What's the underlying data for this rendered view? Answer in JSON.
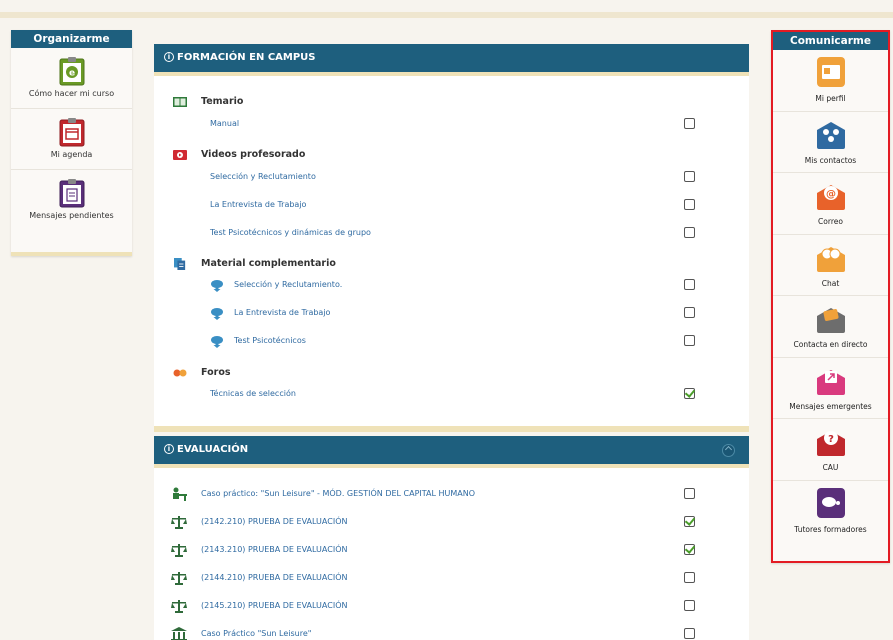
{
  "colors": {
    "header_blue": "#1e5f7e",
    "link_blue": "#2f6aa1",
    "highlight_red": "#e31b23",
    "stripe_beige": "#efe2b8"
  },
  "left_sidebar": {
    "title": "Organizarme",
    "items": [
      {
        "label": "Cómo hacer mi curso",
        "icon": "clipboard-question-icon"
      },
      {
        "label": "Mi agenda",
        "icon": "clipboard-calendar-icon"
      },
      {
        "label": "Mensajes pendientes",
        "icon": "clipboard-document-icon"
      }
    ]
  },
  "right_sidebar": {
    "title": "Comunicarme",
    "items": [
      {
        "label": "Mi perfil",
        "icon": "profile-card-icon"
      },
      {
        "label": "Mis contactos",
        "icon": "contacts-icon"
      },
      {
        "label": "Correo",
        "icon": "mail-at-icon"
      },
      {
        "label": "Chat",
        "icon": "chat-icon"
      },
      {
        "label": "Contacta en directo",
        "icon": "live-contact-icon"
      },
      {
        "label": "Mensajes emergentes",
        "icon": "popup-messages-icon"
      },
      {
        "label": "CAU",
        "icon": "help-desk-icon"
      },
      {
        "label": "Tutores formadores",
        "icon": "tutors-icon"
      }
    ]
  },
  "formacion": {
    "title": "FORMACIÓN EN CAMPUS",
    "categories": [
      {
        "title": "Temario",
        "icon": "book-icon",
        "items": [
          {
            "label": "Manual",
            "checked": false
          }
        ]
      },
      {
        "title": "Videos profesorado",
        "icon": "video-icon",
        "items": [
          {
            "label": "Selección y Reclutamiento",
            "checked": false
          },
          {
            "label": "La Entrevista de Trabajo",
            "checked": false
          },
          {
            "label": "Test Psicotécnicos y dinámicas de grupo",
            "checked": false
          }
        ]
      },
      {
        "title": "Material complementario",
        "icon": "documents-icon",
        "items": [
          {
            "label": "Selección y Reclutamiento.",
            "checked": false,
            "icon": "cloud-download-icon"
          },
          {
            "label": "La Entrevista de Trabajo",
            "checked": false,
            "icon": "cloud-download-icon"
          },
          {
            "label": "Test Psicotécnicos",
            "checked": false,
            "icon": "cloud-download-icon"
          }
        ]
      },
      {
        "title": "Foros",
        "icon": "forum-icon",
        "items": [
          {
            "label": "Técnicas de selección",
            "checked": true
          }
        ]
      }
    ]
  },
  "evaluacion": {
    "title": "EVALUACIÓN",
    "items": [
      {
        "label": "Caso práctico: \"Sun Leisure\" - MÓD. GESTIÓN DEL CAPITAL HUMANO",
        "checked": false,
        "icon": "desk-worker-icon"
      },
      {
        "label": "(2142.210) PRUEBA DE EVALUACIÓN",
        "checked": true,
        "icon": "scale-icon"
      },
      {
        "label": "(2143.210) PRUEBA DE EVALUACIÓN",
        "checked": true,
        "icon": "scale-icon"
      },
      {
        "label": "(2144.210) PRUEBA DE EVALUACIÓN",
        "checked": false,
        "icon": "scale-icon"
      },
      {
        "label": "(2145.210) PRUEBA DE EVALUACIÓN",
        "checked": false,
        "icon": "scale-icon"
      },
      {
        "label": "Caso Práctico \"Sun Leisure\"",
        "checked": false,
        "icon": "building-icon"
      }
    ]
  }
}
